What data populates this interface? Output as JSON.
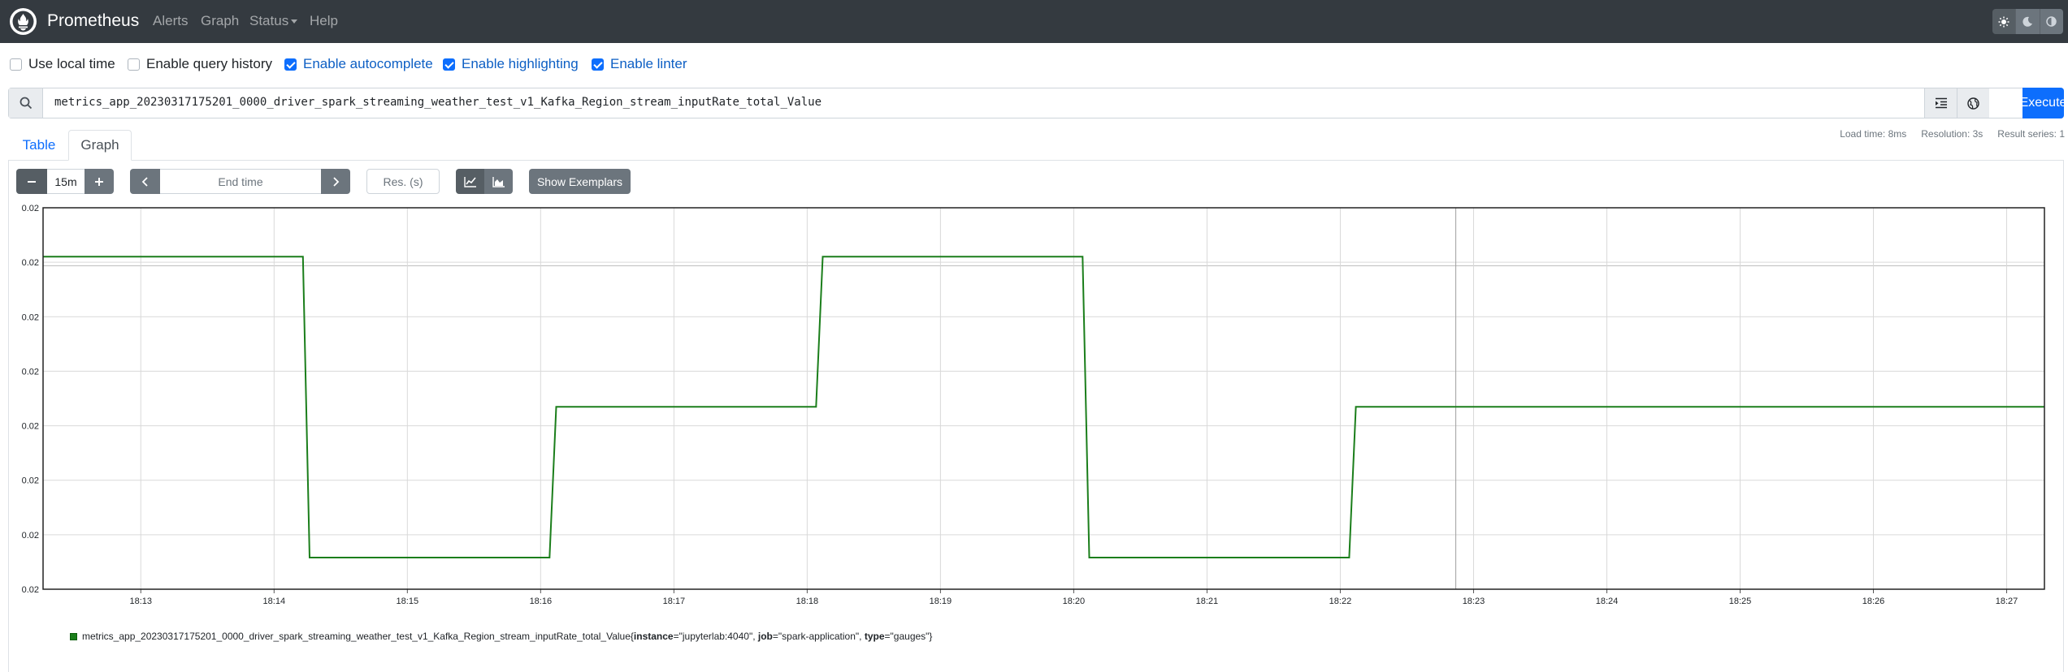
{
  "navbar": {
    "brand": "Prometheus",
    "items": [
      "Alerts",
      "Graph",
      "Status",
      "Help"
    ]
  },
  "options": [
    {
      "label": "Use local time",
      "checked": false
    },
    {
      "label": "Enable query history",
      "checked": false
    },
    {
      "label": "Enable autocomplete",
      "checked": true
    },
    {
      "label": "Enable highlighting",
      "checked": true
    },
    {
      "label": "Enable linter",
      "checked": true
    }
  ],
  "query": {
    "expression": "metrics_app_20230317175201_0000_driver_spark_streaming_weather_test_v1_Kafka_Region_stream_inputRate_total_Value",
    "execute_label": "Execute"
  },
  "tabs": {
    "table": "Table",
    "graph": "Graph"
  },
  "stats": {
    "load_time": "Load time: 8ms",
    "resolution": "Resolution: 3s",
    "result_series": "Result series: 1"
  },
  "controls": {
    "range_value": "15m",
    "end_time_placeholder": "End time",
    "resolution_placeholder": "Res. (s)",
    "exemplars_label": "Show Exemplars"
  },
  "colors": {
    "navbar": "#343a40",
    "accent": "#0d6efd",
    "series": "#1b7e1b"
  },
  "chart_data": {
    "type": "line",
    "y_tick_labels": [
      "0.02",
      "0.02",
      "0.02",
      "0.02",
      "0.02",
      "0.02",
      "0.02",
      "0.02"
    ],
    "x_tick_labels": [
      "18:13",
      "18:14",
      "18:15",
      "18:16",
      "18:17",
      "18:18",
      "18:19",
      "18:20",
      "18:21",
      "18:22",
      "18:23",
      "18:24",
      "18:25",
      "18:26",
      "18:27"
    ],
    "grid": true,
    "legend_position": "bottom-left",
    "series": [
      {
        "name": "metrics_app_20230317175201_0000_driver_spark_streaming_weather_test_v1_Kafka_Region_stream_inputRate_total_Value",
        "labels": [
          {
            "key": "instance",
            "value": "jupyterlab:4040"
          },
          {
            "key": "job",
            "value": "spark-application"
          },
          {
            "key": "type",
            "value": "gauges"
          }
        ],
        "step": [
          {
            "t": "18:12:16",
            "level": "high"
          },
          {
            "t": "18:14:13",
            "level": "high"
          },
          {
            "t": "18:14:16",
            "level": "low"
          },
          {
            "t": "18:16:04",
            "level": "low"
          },
          {
            "t": "18:16:07",
            "level": "mid"
          },
          {
            "t": "18:18:04",
            "level": "mid"
          },
          {
            "t": "18:18:07",
            "level": "high"
          },
          {
            "t": "18:20:04",
            "level": "high"
          },
          {
            "t": "18:20:07",
            "level": "low"
          },
          {
            "t": "18:22:04",
            "level": "low"
          },
          {
            "t": "18:22:07",
            "level": "mid"
          },
          {
            "t": "18:27:17",
            "level": "mid"
          }
        ]
      }
    ]
  }
}
